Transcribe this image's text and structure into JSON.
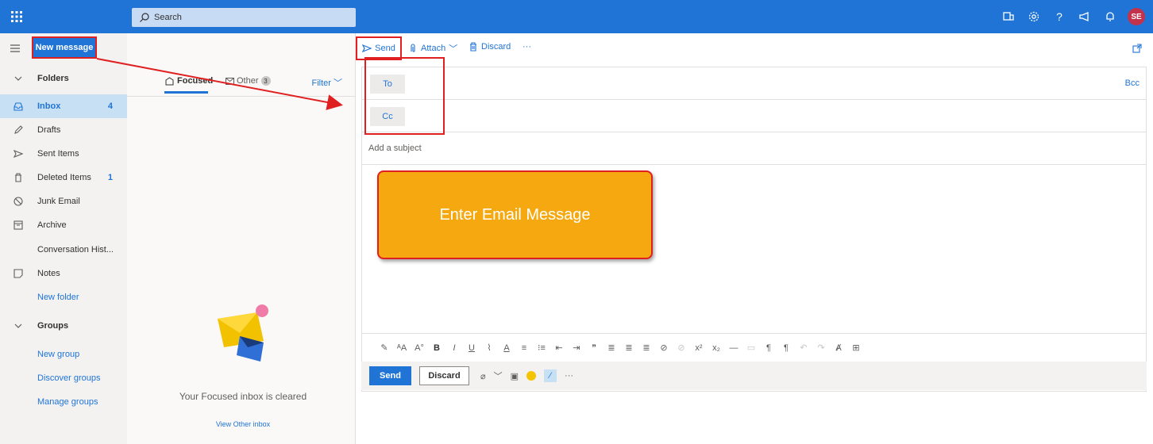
{
  "topbar": {
    "search_placeholder": "Search",
    "avatar_initials": "SE",
    "accent": "#1f74d6"
  },
  "leftnav": {
    "new_message_label": "New message",
    "items": [
      {
        "label": "Folders",
        "count": "",
        "icon": "chevron-down-icon",
        "kind": "head"
      },
      {
        "label": "Inbox",
        "count": "4",
        "icon": "inbox-icon",
        "kind": "selected"
      },
      {
        "label": "Drafts",
        "count": "",
        "icon": "pencil-icon",
        "kind": "normal"
      },
      {
        "label": "Sent Items",
        "count": "",
        "icon": "send-icon",
        "kind": "normal"
      },
      {
        "label": "Deleted Items",
        "count": "1",
        "icon": "trash-icon",
        "kind": "normal"
      },
      {
        "label": "Junk Email",
        "count": "",
        "icon": "blocked-icon",
        "kind": "normal"
      },
      {
        "label": "Archive",
        "count": "",
        "icon": "archive-icon",
        "kind": "normal"
      },
      {
        "label": "Conversation Hist...",
        "count": "",
        "icon": "",
        "kind": "normal"
      },
      {
        "label": "Notes",
        "count": "",
        "icon": "note-icon",
        "kind": "normal"
      },
      {
        "label": "New folder",
        "count": "",
        "icon": "",
        "kind": "link"
      },
      {
        "label": "Groups",
        "count": "",
        "icon": "chevron-down-icon",
        "kind": "head"
      },
      {
        "label": "New group",
        "count": "",
        "icon": "",
        "kind": "link"
      },
      {
        "label": "Discover groups",
        "count": "",
        "icon": "",
        "kind": "link"
      },
      {
        "label": "Manage groups",
        "count": "",
        "icon": "",
        "kind": "link"
      }
    ]
  },
  "midpane": {
    "tab_focused": "Focused",
    "tab_other": "Other",
    "other_count": "3",
    "filter_label": "Filter",
    "empty_text": "Your Focused inbox is cleared",
    "view_other_link": "View Other inbox"
  },
  "compose_toolbar": {
    "send_label": "Send",
    "attach_label": "Attach",
    "discard_label": "Discard",
    "more_label": "···"
  },
  "compose": {
    "to_label": "To",
    "cc_label": "Cc",
    "bcc_label": "Bcc",
    "subject_placeholder": "Add a subject",
    "callout_text": "Enter Email Message"
  },
  "bottom_bar": {
    "send_label": "Send",
    "discard_label": "Discard",
    "more_label": "···"
  }
}
